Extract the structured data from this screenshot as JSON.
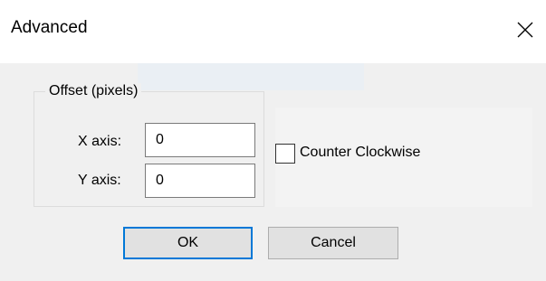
{
  "window": {
    "title": "Advanced",
    "close_icon": "close-icon"
  },
  "offset_group": {
    "label": "Offset (pixels)",
    "x_axis_label": "X axis:",
    "x_axis_value": "0",
    "y_axis_label": "Y axis:",
    "y_axis_value": "0"
  },
  "counter_clockwise": {
    "label": "Counter Clockwise",
    "checked": false
  },
  "buttons": {
    "ok_label": "OK",
    "cancel_label": "Cancel"
  },
  "colors": {
    "accent": "#0078d7",
    "dialog_bg": "#f0f0f0",
    "titlebar_bg": "#ffffff"
  }
}
